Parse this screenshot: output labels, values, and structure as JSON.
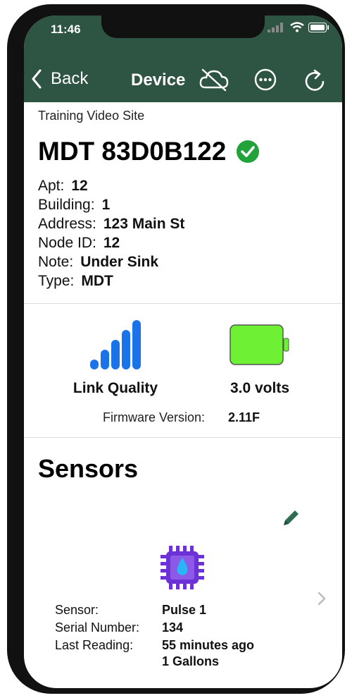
{
  "status_bar": {
    "time": "11:46"
  },
  "nav": {
    "back_label": "Back",
    "title": "Device"
  },
  "device": {
    "site": "Training Video Site",
    "name": "MDT 83D0B122",
    "details": [
      {
        "label": "Apt:",
        "value": "12"
      },
      {
        "label": "Building:",
        "value": "1"
      },
      {
        "label": "Address:",
        "value": "123 Main St"
      },
      {
        "label": "Node ID:",
        "value": "12"
      },
      {
        "label": "Note:",
        "value": "Under Sink"
      },
      {
        "label": "Type:",
        "value": "MDT"
      }
    ]
  },
  "metrics": {
    "link_label": "Link Quality",
    "battery_label": "3.0 volts",
    "firmware_label": "Firmware Version:",
    "firmware_value": "2.11F"
  },
  "sensors": {
    "heading": "Sensors",
    "items": [
      {
        "sensor_label": "Sensor:",
        "sensor_value": "Pulse 1",
        "serial_label": "Serial Number:",
        "serial_value": "134",
        "reading_label": "Last Reading:",
        "reading_value": "55 minutes ago",
        "amount_value": "1  Gallons"
      }
    ]
  },
  "colors": {
    "header": "#2e5443",
    "battery": "#6ef034",
    "signal": "#1a73e8",
    "chip": "#6c32d8",
    "check": "#22a33a"
  }
}
